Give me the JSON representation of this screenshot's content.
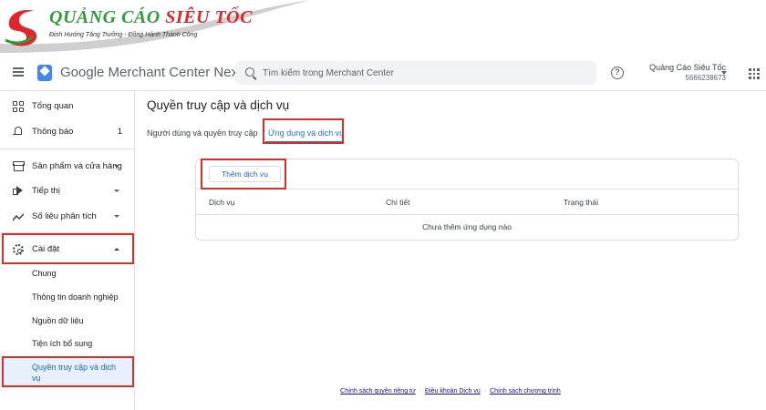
{
  "watermark": {
    "brand_part1": "QUẢNG CÁO",
    "brand_part2": "SIÊU TỐC",
    "tagline": "Định Hướng Tăng Trưởng - Đồng Hành Thành Công"
  },
  "header": {
    "app_title": "Google Merchant Center Next",
    "search_placeholder": "Tìm kiếm trong Merchant Center",
    "help_glyph": "?",
    "account_name": "Quảng Cáo Siêu Tốc",
    "account_id": "5666238673"
  },
  "sidebar": {
    "items": [
      {
        "label": "Tổng quan",
        "icon": "dashboard-icon"
      },
      {
        "label": "Thông báo",
        "icon": "bell-icon",
        "count": "1"
      },
      {
        "label": "Sản phẩm và cửa hàng",
        "icon": "storefront-icon"
      },
      {
        "label": "Tiếp thị",
        "icon": "megaphone-icon"
      },
      {
        "label": "Số liệu phân tích",
        "icon": "trending-icon"
      },
      {
        "label": "Cài đặt",
        "icon": "gear-icon",
        "expanded": true
      }
    ],
    "settings_sub": [
      {
        "label": "Chung"
      },
      {
        "label": "Thông tin doanh nghiệp"
      },
      {
        "label": "Nguồn dữ liệu"
      },
      {
        "label": "Tiện ích bổ sung"
      },
      {
        "label": "Quyền truy cập và dịch vụ",
        "active": true
      }
    ]
  },
  "main": {
    "title": "Quyền truy cập và dịch vụ",
    "tabs": [
      {
        "label": "Người dùng và quyền truy cập",
        "active": false
      },
      {
        "label": "Ứng dụng và dịch vụ",
        "active": true
      }
    ],
    "add_button": "Thêm dịch vụ",
    "table": {
      "columns": [
        "Dịch vụ",
        "Chi tiết",
        "Trạng thái"
      ],
      "empty_message": "Chưa thêm ứng dụng nào"
    }
  },
  "footer": {
    "links": [
      "Chính sách quyền riêng tư",
      "Điều khoản Dịch vụ",
      "Chính sách chương trình"
    ],
    "separator": "·"
  },
  "colors": {
    "accent": "#1a73e8",
    "highlight_box": "#d93025",
    "active_nav_bg": "#e8f0fe",
    "brand_green": "#2e9c3a",
    "brand_red": "#e3242b"
  }
}
